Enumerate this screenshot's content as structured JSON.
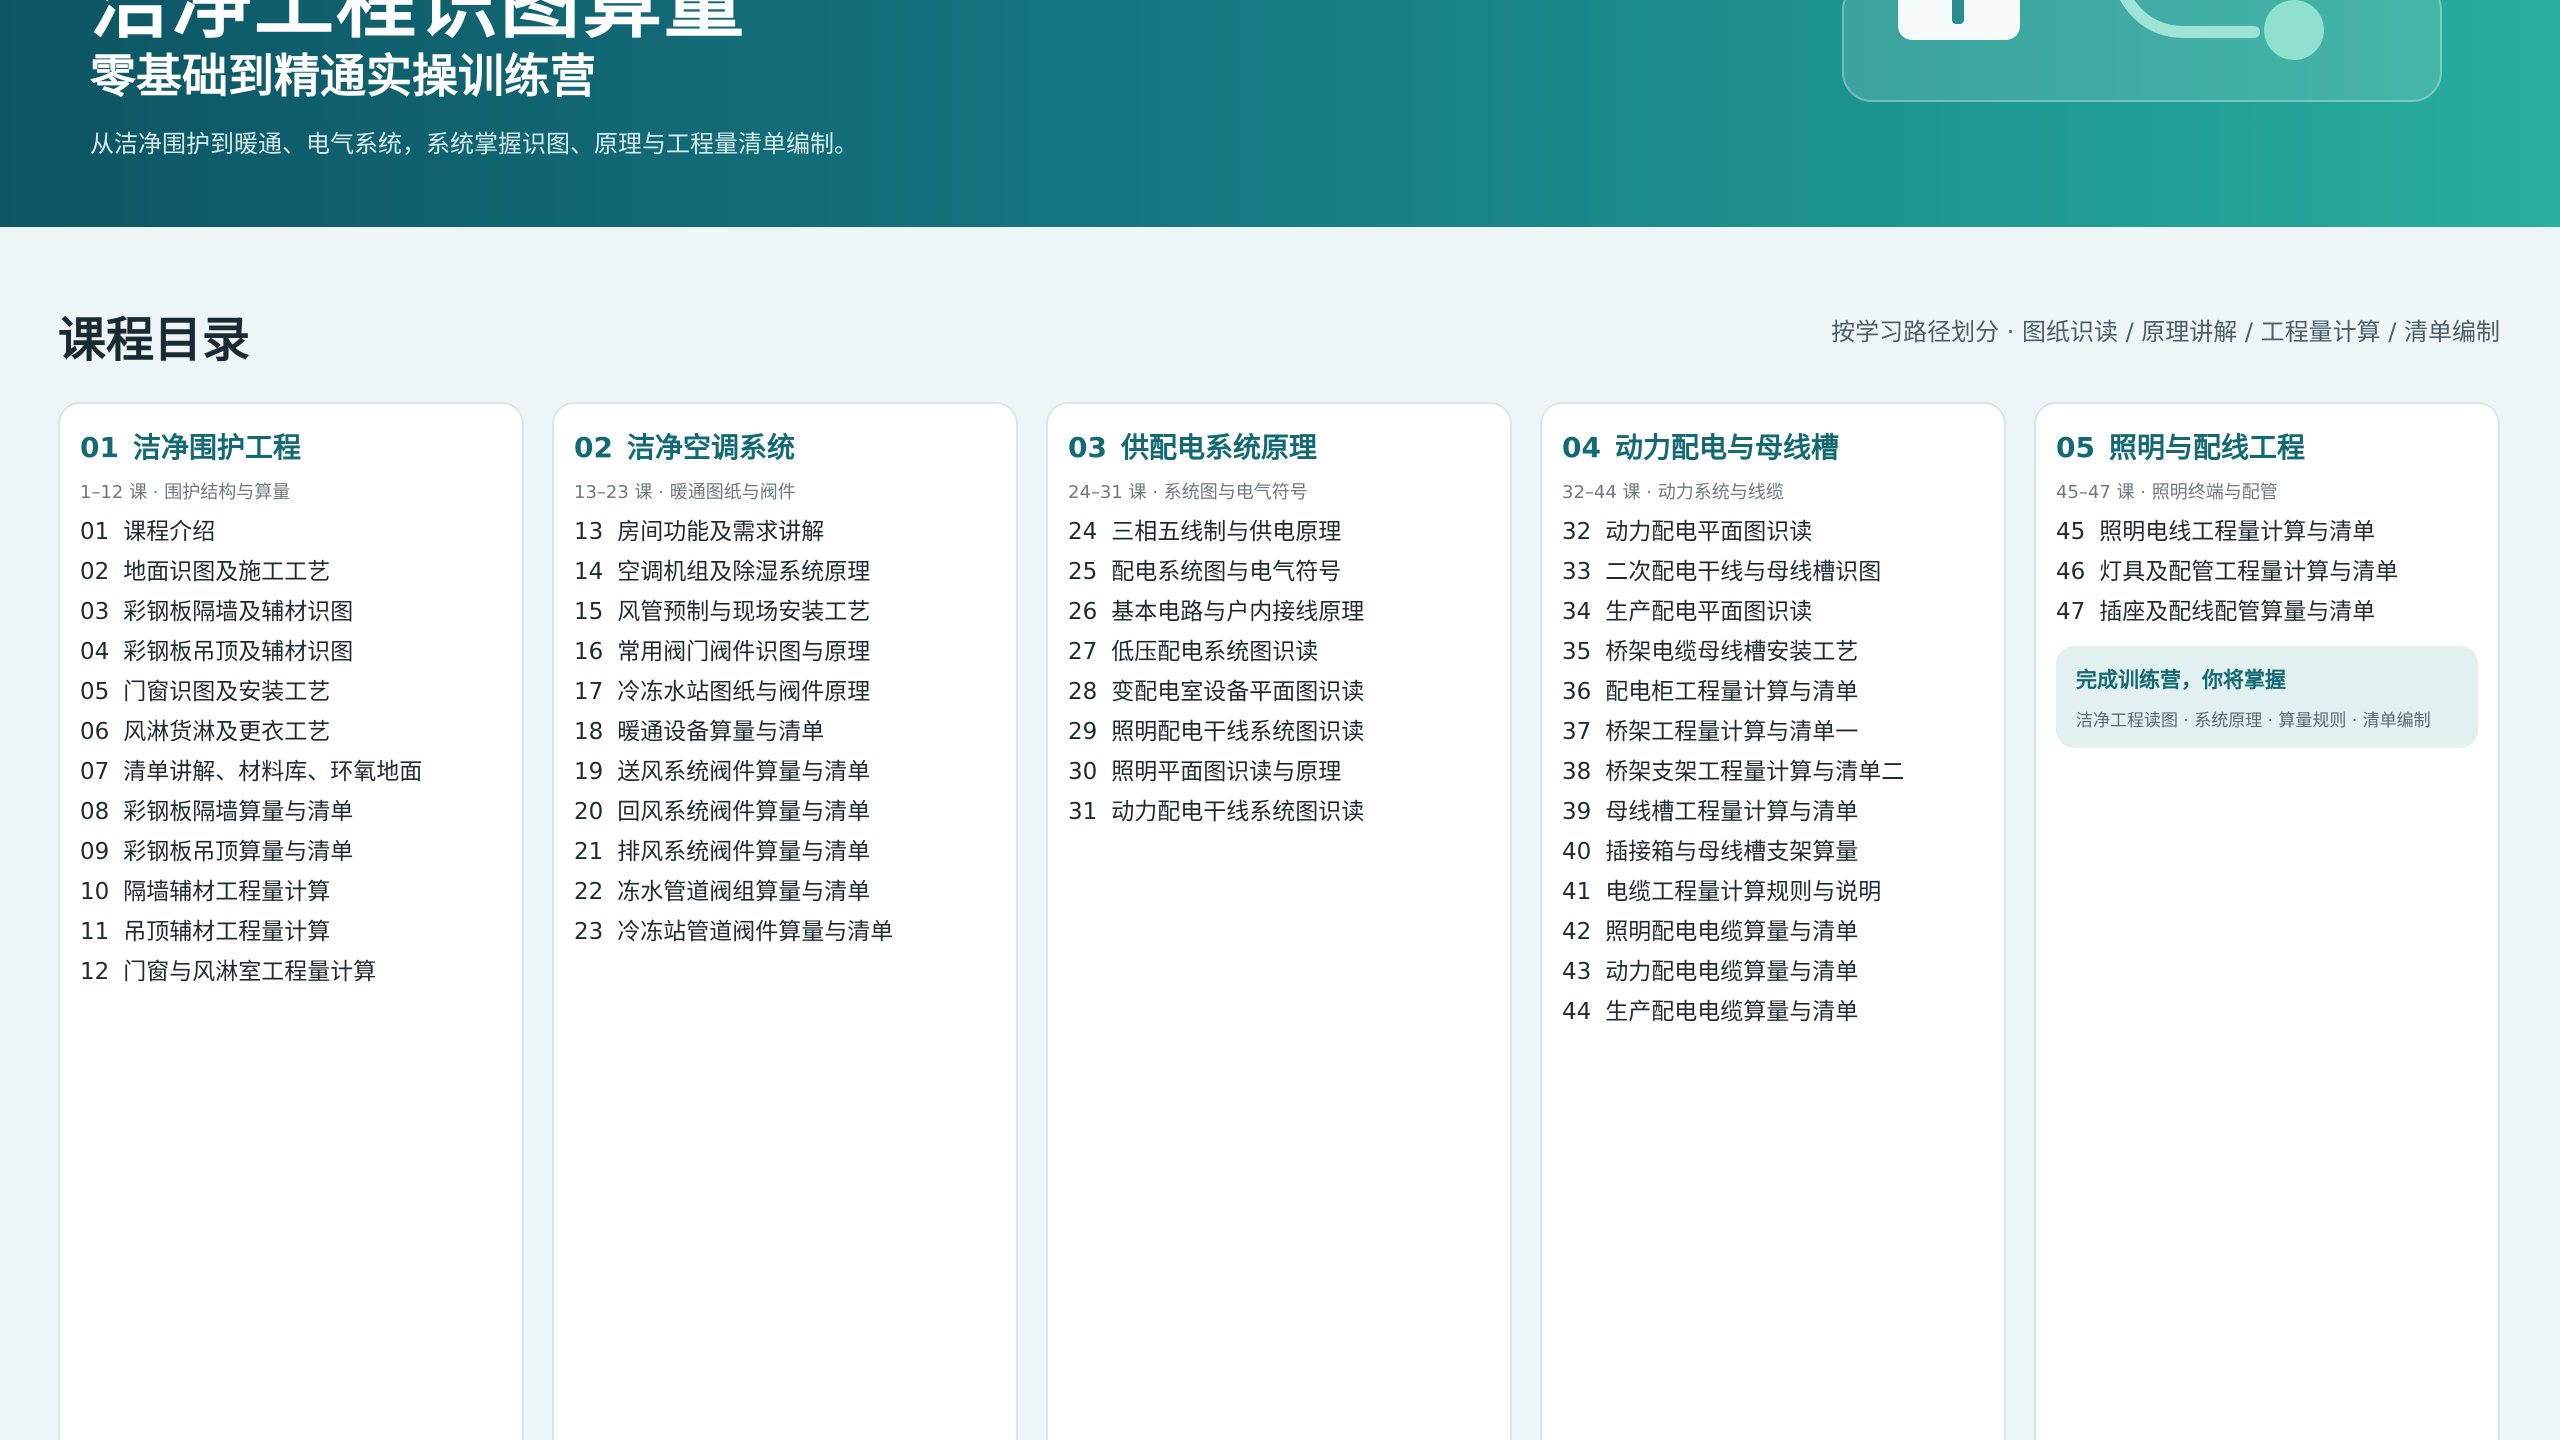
{
  "hero": {
    "big_title": "洁净工程识图算量",
    "subtitle": "零基础到精通实操训练营",
    "description": "从洁净围护到暖通、电气系统，系统掌握识图、原理与工程量清单编制。"
  },
  "section": {
    "title": "课程目录",
    "note": "按学习路径划分 · 图纸识读 / 原理讲解 / 工程量计算 / 清单编制"
  },
  "modules": [
    {
      "num": "01",
      "title": "洁净围护工程",
      "meta": "1–12 课 · 围护结构与算量",
      "lessons": [
        {
          "num": "01",
          "title": "课程介绍"
        },
        {
          "num": "02",
          "title": "地面识图及施工工艺"
        },
        {
          "num": "03",
          "title": "彩钢板隔墙及辅材识图"
        },
        {
          "num": "04",
          "title": "彩钢板吊顶及辅材识图"
        },
        {
          "num": "05",
          "title": "门窗识图及安装工艺"
        },
        {
          "num": "06",
          "title": "风淋货淋及更衣工艺"
        },
        {
          "num": "07",
          "title": "清单讲解、材料库、环氧地面"
        },
        {
          "num": "08",
          "title": "彩钢板隔墙算量与清单"
        },
        {
          "num": "09",
          "title": "彩钢板吊顶算量与清单"
        },
        {
          "num": "10",
          "title": "隔墙辅材工程量计算"
        },
        {
          "num": "11",
          "title": "吊顶辅材工程量计算"
        },
        {
          "num": "12",
          "title": "门窗与风淋室工程量计算"
        }
      ]
    },
    {
      "num": "02",
      "title": "洁净空调系统",
      "meta": "13–23 课 · 暖通图纸与阀件",
      "lessons": [
        {
          "num": "13",
          "title": "房间功能及需求讲解"
        },
        {
          "num": "14",
          "title": "空调机组及除湿系统原理"
        },
        {
          "num": "15",
          "title": "风管预制与现场安装工艺"
        },
        {
          "num": "16",
          "title": "常用阀门阀件识图与原理"
        },
        {
          "num": "17",
          "title": "冷冻水站图纸与阀件原理"
        },
        {
          "num": "18",
          "title": "暖通设备算量与清单"
        },
        {
          "num": "19",
          "title": "送风系统阀件算量与清单"
        },
        {
          "num": "20",
          "title": "回风系统阀件算量与清单"
        },
        {
          "num": "21",
          "title": "排风系统阀件算量与清单"
        },
        {
          "num": "22",
          "title": "冻水管道阀组算量与清单"
        },
        {
          "num": "23",
          "title": "冷冻站管道阀件算量与清单"
        }
      ]
    },
    {
      "num": "03",
      "title": "供配电系统原理",
      "meta": "24–31 课 · 系统图与电气符号",
      "lessons": [
        {
          "num": "24",
          "title": "三相五线制与供电原理"
        },
        {
          "num": "25",
          "title": "配电系统图与电气符号"
        },
        {
          "num": "26",
          "title": "基本电路与户内接线原理"
        },
        {
          "num": "27",
          "title": "低压配电系统图识读"
        },
        {
          "num": "28",
          "title": "变配电室设备平面图识读"
        },
        {
          "num": "29",
          "title": "照明配电干线系统图识读"
        },
        {
          "num": "30",
          "title": "照明平面图识读与原理"
        },
        {
          "num": "31",
          "title": "动力配电干线系统图识读"
        }
      ]
    },
    {
      "num": "04",
      "title": "动力配电与母线槽",
      "meta": "32–44 课 · 动力系统与线缆",
      "lessons": [
        {
          "num": "32",
          "title": "动力配电平面图识读"
        },
        {
          "num": "33",
          "title": "二次配电干线与母线槽识图"
        },
        {
          "num": "34",
          "title": "生产配电平面图识读"
        },
        {
          "num": "35",
          "title": "桥架电缆母线槽安装工艺"
        },
        {
          "num": "36",
          "title": "配电柜工程量计算与清单"
        },
        {
          "num": "37",
          "title": "桥架工程量计算与清单一"
        },
        {
          "num": "38",
          "title": "桥架支架工程量计算与清单二"
        },
        {
          "num": "39",
          "title": "母线槽工程量计算与清单"
        },
        {
          "num": "40",
          "title": "插接箱与母线槽支架算量"
        },
        {
          "num": "41",
          "title": "电缆工程量计算规则与说明"
        },
        {
          "num": "42",
          "title": "照明配电电缆算量与清单"
        },
        {
          "num": "43",
          "title": "动力配电电缆算量与清单"
        },
        {
          "num": "44",
          "title": "生产配电电缆算量与清单"
        }
      ]
    },
    {
      "num": "05",
      "title": "照明与配线工程",
      "meta": "45–47 课 · 照明终端与配管",
      "lessons": [
        {
          "num": "45",
          "title": "照明电线工程量计算与清单"
        },
        {
          "num": "46",
          "title": "灯具及配管工程量计算与清单"
        },
        {
          "num": "47",
          "title": "插座及配线配管算量与清单"
        }
      ],
      "finish": {
        "title": "完成训练营，你将掌握",
        "desc": "洁净工程读图 · 系统原理 · 算量规则 · 清单编制"
      }
    }
  ]
}
